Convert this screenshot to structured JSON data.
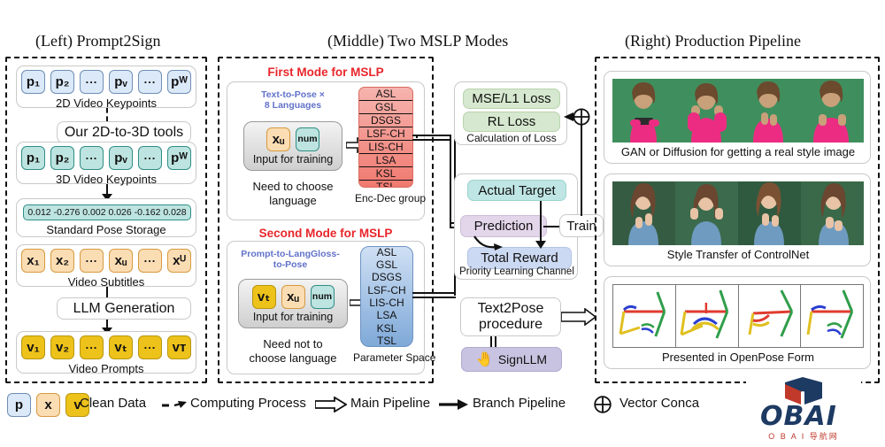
{
  "titles": {
    "left": "(Left) Prompt2Sign",
    "middle": "(Middle) Two MSLP Modes",
    "right": "(Right) Production Pipeline"
  },
  "left_panel": {
    "keypoints_2d": {
      "caption": "2D Video Keypoints",
      "tokens": [
        "p₁",
        "p₂",
        "...",
        "pᵥ",
        "...",
        "pᵂ"
      ]
    },
    "tool_box": "Our 2D-to-3D tools",
    "keypoints_3d": {
      "caption": "3D Video Keypoints",
      "tokens": [
        "p₁",
        "p₂",
        "...",
        "pᵥ",
        "...",
        "pᵂ"
      ]
    },
    "pose_storage": {
      "caption": "Standard Pose Storage",
      "values": "0.012 -0.276 0.002 0.026 -0.162 0.028"
    },
    "subtitles": {
      "caption": "Video Subtitles",
      "tokens": [
        "x₁",
        "x₂",
        "...",
        "xᵤ",
        "...",
        "xᵁ"
      ]
    },
    "llm_box": "LLM Generation",
    "prompts": {
      "caption": "Video Prompts",
      "tokens": [
        "v₁",
        "v₂",
        "...",
        "vₜ",
        "...",
        "vᴛ"
      ]
    }
  },
  "middle_panel": {
    "first_mode": {
      "label": "First Mode for MSLP",
      "sub_label": "Text-to-Pose ×\n8 Languages",
      "input_label": "Input for training",
      "input_tokens": [
        "xᵤ",
        "num"
      ],
      "note": "Need to choose\nlanguage",
      "group_caption": "Enc-Dec group",
      "languages": [
        "ASL",
        "GSL",
        "DSGS",
        "LSF-CH",
        "LIS-CH",
        "LSA",
        "KSL",
        "TSL"
      ]
    },
    "second_mode": {
      "label": "Second Mode for MSLP",
      "sub_label": "Prompt-to-LangGloss-\nto-Pose",
      "input_label": "Input for training",
      "input_tokens": [
        "vₜ",
        "xᵤ",
        "num"
      ],
      "note": "Need not to\nchoose language",
      "group_caption": "Parameter Space",
      "languages": [
        "ASL",
        "GSL",
        "DSGS",
        "LSF-CH",
        "LIS-CH",
        "LSA",
        "KSL",
        "TSL"
      ]
    }
  },
  "center_panel": {
    "loss": {
      "caption": "Calculation of Loss",
      "items": [
        "MSE/L1 Loss",
        "RL Loss"
      ]
    },
    "priority": {
      "caption": "Priority Learning Channel",
      "actual_target": "Actual Target",
      "prediction": "Prediction",
      "total_reward": "Total Reward",
      "train": "Train"
    },
    "text2pose": "Text2Pose\nprocedure",
    "signllm": "SignLLM"
  },
  "right_panel": {
    "gan": "GAN or Diffusion for getting a real style image",
    "controlnet": "Style Transfer of ControlNet",
    "openpose": "Presented in OpenPose Form"
  },
  "legend": {
    "chips": [
      "p",
      "x",
      "v"
    ],
    "items": [
      {
        "label": "Clean Data",
        "icon": "dashed-arrow-icon"
      },
      {
        "label": "Computing Process",
        "icon": "hollow-arrow-icon"
      },
      {
        "label": "Main Pipeline",
        "icon": "solid-arrow-icon"
      },
      {
        "label": "Branch Pipeline",
        "icon": "circle-plus-icon"
      },
      {
        "label": "Vector Conca",
        "icon": ""
      }
    ]
  },
  "logo": {
    "name": "OBAI",
    "sub": "O B A I 导航网"
  },
  "colors": {
    "accent_red": "#e8262b",
    "accent_blue": "#6272c9",
    "chip_p": "#dbe9f8",
    "chip_p3": "#bde4e0",
    "chip_x": "#fbddb4",
    "chip_v": "#edc21a"
  }
}
